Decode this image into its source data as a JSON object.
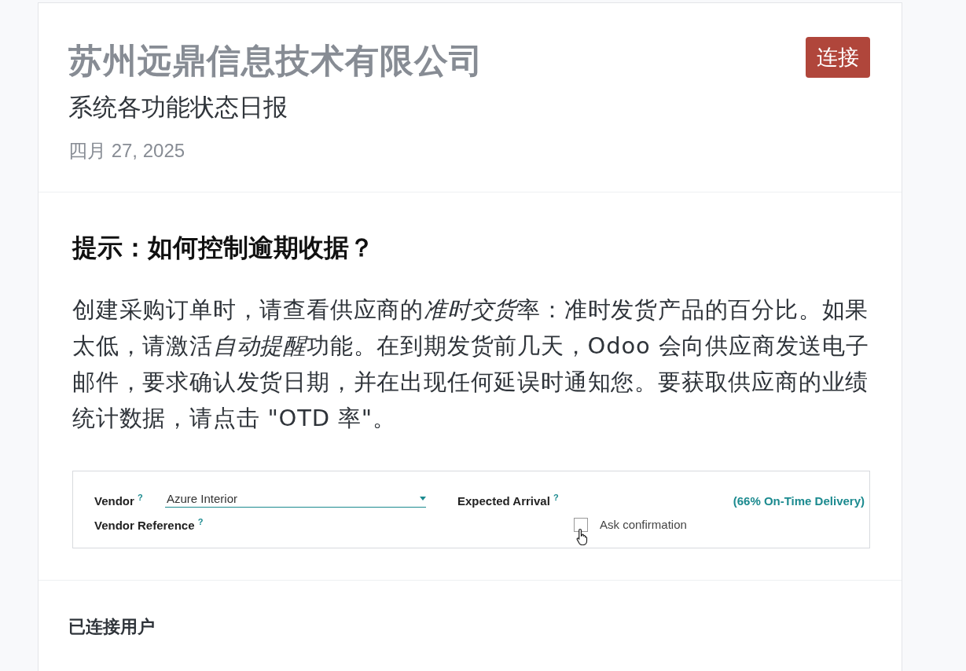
{
  "header": {
    "company": "苏州远鼎信息技术有限公司",
    "subtitle": "系统各功能状态日报",
    "date": "四月 27, 2025",
    "connect_button": "连接"
  },
  "tip": {
    "title": "提示：如何控制逾期收据？",
    "body": [
      {
        "text": "创建采购订单时，请查看供应商的",
        "italic": false
      },
      {
        "text": "准时交货",
        "italic": true
      },
      {
        "text": "率：准时发货产品的百分比。如果太低，请激活",
        "italic": false
      },
      {
        "text": "自动提醒",
        "italic": true
      },
      {
        "text": "功能。在到期发货前几天，Odoo 会向供应商发送电子邮件，要求确认发货日期，并在出现任何延误时通知您。要获取供应商的业绩统计数据，请点击 \"OTD 率\"。",
        "italic": false
      }
    ],
    "form": {
      "vendor_label": "Vendor",
      "vendor_help": "?",
      "vendor_value": "Azure Interior",
      "arrival_label": "Expected Arrival",
      "arrival_help": "?",
      "on_time": "(66% On-Time Delivery)",
      "reference_label": "Vendor Reference",
      "reference_help": "?",
      "ask_confirmation": {
        "label": "Ask confirmation",
        "checked": false
      }
    }
  },
  "connected_users": {
    "title": "已连接用户"
  }
}
